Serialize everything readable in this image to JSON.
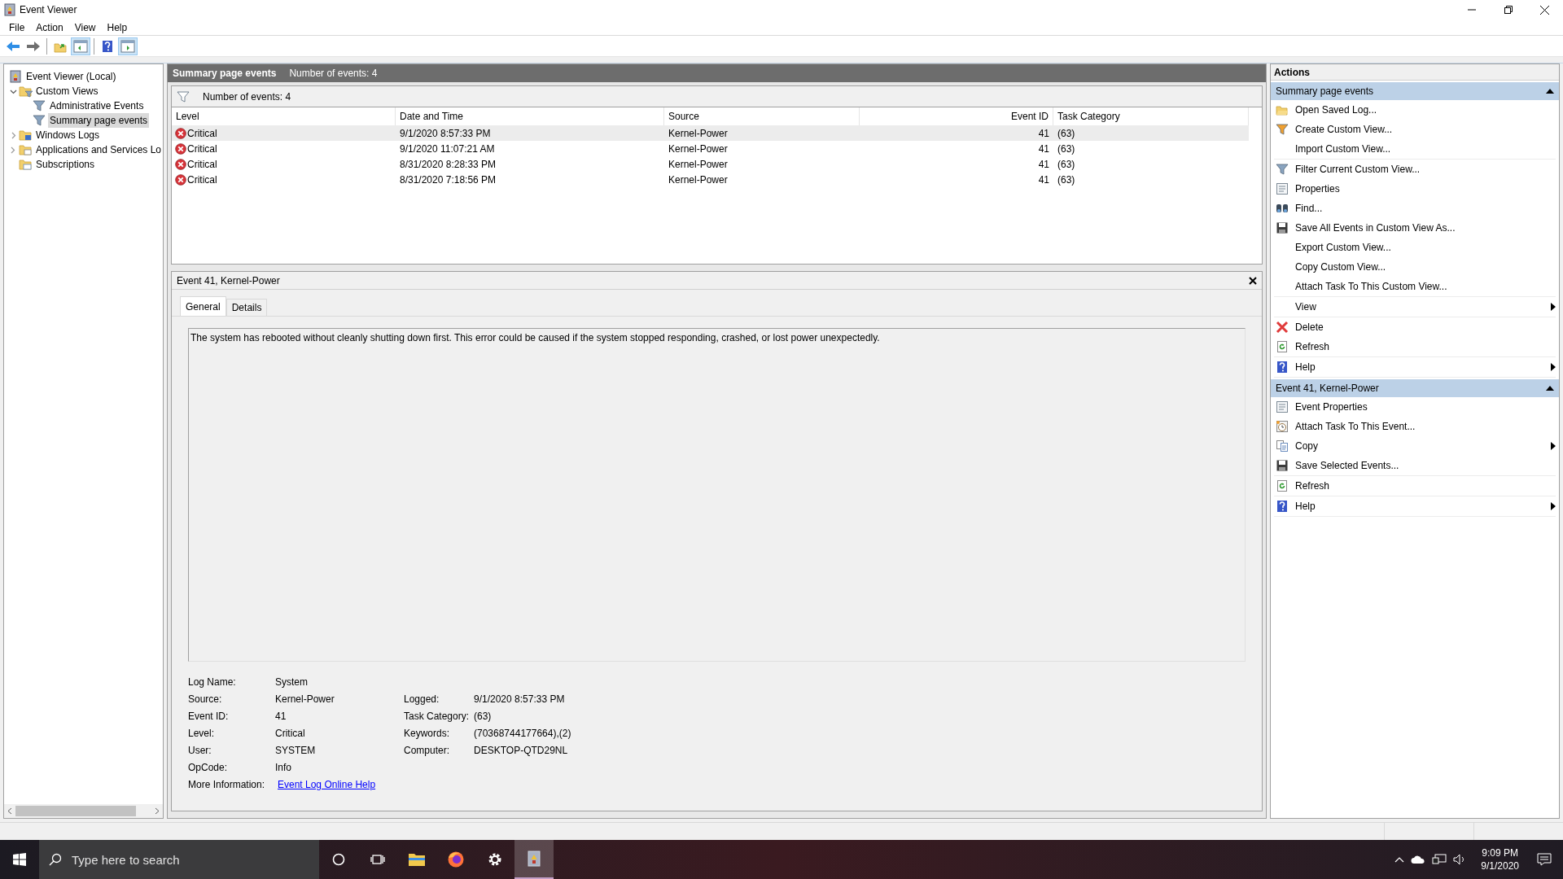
{
  "window": {
    "title": "Event Viewer"
  },
  "menu": [
    "File",
    "Action",
    "View",
    "Help"
  ],
  "toolbar": [
    {
      "kind": "back",
      "pressed": false
    },
    {
      "kind": "forward",
      "pressed": false
    },
    {
      "kind": "sep"
    },
    {
      "kind": "up",
      "pressed": false
    },
    {
      "kind": "tree",
      "pressed": true
    },
    {
      "kind": "sep"
    },
    {
      "kind": "help",
      "pressed": false
    },
    {
      "kind": "actionpane",
      "pressed": true
    }
  ],
  "tree": [
    {
      "label": "Event Viewer (Local)",
      "kind": "computer",
      "selected": false,
      "children": [
        {
          "label": "Custom Views",
          "kind": "folder-filter",
          "selected": false,
          "expanded": true,
          "children": [
            {
              "label": "Administrative Events",
              "kind": "filter",
              "selected": false
            },
            {
              "label": "Summary page events",
              "kind": "filter",
              "selected": true
            }
          ]
        },
        {
          "label": "Windows Logs",
          "kind": "folder-logs",
          "selected": false,
          "expanded": false
        },
        {
          "label": "Applications and Services Lo",
          "kind": "folder-apps",
          "selected": false,
          "expanded": false
        },
        {
          "label": "Subscriptions",
          "kind": "folder-subs",
          "selected": false
        }
      ]
    }
  ],
  "summary_header": {
    "title": "Summary page events",
    "count": "Number of events: 4"
  },
  "filter_bar": {
    "text": "Number of events: 4"
  },
  "table": {
    "columns": [
      "Level",
      "Date and Time",
      "Source",
      "Event ID",
      "Task Category"
    ],
    "rows": [
      {
        "selected": true,
        "cells": [
          "Critical",
          "9/1/2020 8:57:33 PM",
          "Kernel-Power",
          "41",
          "(63)"
        ]
      },
      {
        "selected": false,
        "cells": [
          "Critical",
          "9/1/2020 11:07:21 AM",
          "Kernel-Power",
          "41",
          "(63)"
        ]
      },
      {
        "selected": false,
        "cells": [
          "Critical",
          "8/31/2020 8:28:33 PM",
          "Kernel-Power",
          "41",
          "(63)"
        ]
      },
      {
        "selected": false,
        "cells": [
          "Critical",
          "8/31/2020 7:18:56 PM",
          "Kernel-Power",
          "41",
          "(63)"
        ]
      }
    ]
  },
  "detail": {
    "title": "Event 41, Kernel-Power",
    "tabs": [
      {
        "label": "General",
        "selected": true
      },
      {
        "label": "Details",
        "selected": false
      }
    ],
    "description": "The system has rebooted without cleanly shutting down first. This error could be caused if the system stopped responding, crashed, or lost power unexpectedly.",
    "fields_left": [
      {
        "label": "Log Name:",
        "value": "System"
      },
      {
        "label": "Source:",
        "value": "Kernel-Power"
      },
      {
        "label": "Event ID:",
        "value": "41"
      },
      {
        "label": "Level:",
        "value": "Critical"
      },
      {
        "label": "User:",
        "value": "SYSTEM"
      },
      {
        "label": "OpCode:",
        "value": "Info"
      }
    ],
    "fields_right": [
      {
        "label": "Logged:",
        "value": "9/1/2020 8:57:33 PM"
      },
      {
        "label": "Task Category:",
        "value": "(63)"
      },
      {
        "label": "Keywords:",
        "value": "(70368744177664),(2)"
      },
      {
        "label": "Computer:",
        "value": "DESKTOP-QTD29NL"
      }
    ],
    "more_info": {
      "label": "More Information:",
      "link": "Event Log Online Help"
    }
  },
  "actions": {
    "title": "Actions",
    "sections": [
      {
        "title": "Summary page events",
        "expanded": true,
        "groups": [
          [
            {
              "label": "Open Saved Log...",
              "kind": "open",
              "submenu": false
            },
            {
              "label": "Create Custom View...",
              "kind": "create-filter",
              "submenu": false
            },
            {
              "label": "Import Custom View...",
              "kind": "none",
              "submenu": false
            }
          ],
          [
            {
              "label": "Filter Current Custom View...",
              "kind": "filter",
              "submenu": false
            },
            {
              "label": "Properties",
              "kind": "properties",
              "submenu": false
            },
            {
              "label": "Find...",
              "kind": "find",
              "submenu": false
            },
            {
              "label": "Save All Events in Custom View As...",
              "kind": "save",
              "submenu": false
            },
            {
              "label": "Export Custom View...",
              "kind": "none",
              "submenu": false
            },
            {
              "label": "Copy Custom View...",
              "kind": "none",
              "submenu": false
            },
            {
              "label": "Attach Task To This Custom View...",
              "kind": "none",
              "submenu": false
            }
          ],
          [
            {
              "label": "View",
              "kind": "none",
              "submenu": true
            }
          ],
          [
            {
              "label": "Delete",
              "kind": "delete",
              "submenu": false
            },
            {
              "label": "Refresh",
              "kind": "refresh",
              "submenu": false
            }
          ],
          [
            {
              "label": "Help",
              "kind": "help",
              "submenu": true
            }
          ]
        ]
      },
      {
        "title": "Event 41, Kernel-Power",
        "expanded": true,
        "groups": [
          [
            {
              "label": "Event Properties",
              "kind": "properties",
              "submenu": false
            },
            {
              "label": "Attach Task To This Event...",
              "kind": "attach",
              "submenu": false
            },
            {
              "label": "Copy",
              "kind": "copy",
              "submenu": true
            },
            {
              "label": "Save Selected Events...",
              "kind": "save",
              "submenu": false
            }
          ],
          [
            {
              "label": "Refresh",
              "kind": "refresh",
              "submenu": false
            }
          ],
          [
            {
              "label": "Help",
              "kind": "help",
              "submenu": true
            }
          ]
        ]
      }
    ]
  },
  "taskbar": {
    "search_placeholder": "Type here to search",
    "apps": [
      {
        "kind": "cortana",
        "selected": false
      },
      {
        "kind": "taskview",
        "selected": false
      },
      {
        "kind": "explorer",
        "selected": false
      },
      {
        "kind": "firefox",
        "selected": false
      },
      {
        "kind": "settings",
        "selected": false
      },
      {
        "kind": "eventviewer",
        "selected": true
      }
    ],
    "time": "9:09 PM",
    "date": "9/1/2020"
  }
}
